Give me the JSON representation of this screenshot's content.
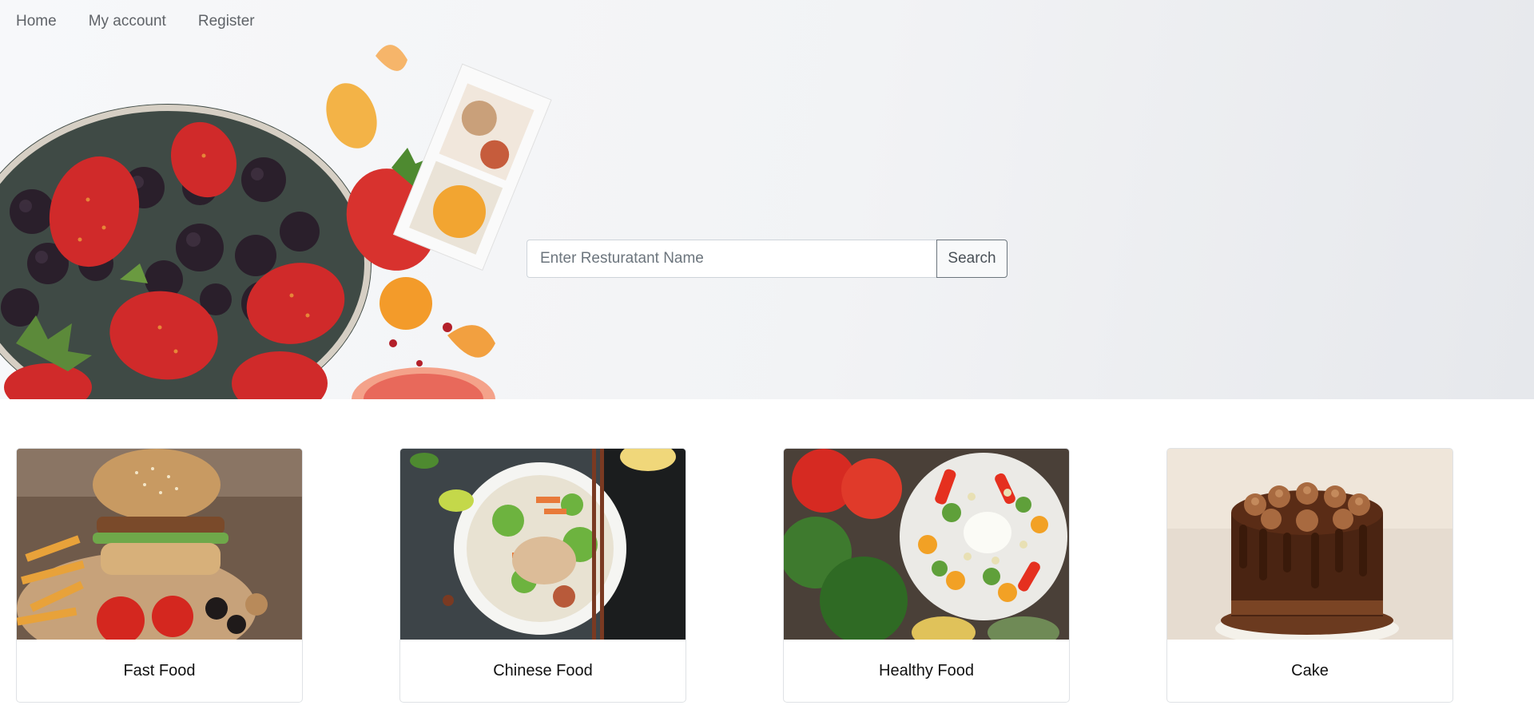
{
  "nav": {
    "items": [
      {
        "label": "Home"
      },
      {
        "label": "My account"
      },
      {
        "label": "Register"
      }
    ]
  },
  "search": {
    "placeholder": "Enter Resturatant Name",
    "button_label": "Search"
  },
  "categories": [
    {
      "label": "Fast Food",
      "image": "burger-fries-photo"
    },
    {
      "label": "Chinese Food",
      "image": "noodle-bowl-photo"
    },
    {
      "label": "Healthy Food",
      "image": "salad-plate-photo"
    },
    {
      "label": "Cake",
      "image": "chocolate-cake-photo"
    }
  ],
  "hero": {
    "image": "strawberry-blackberry-bowl-photo"
  }
}
